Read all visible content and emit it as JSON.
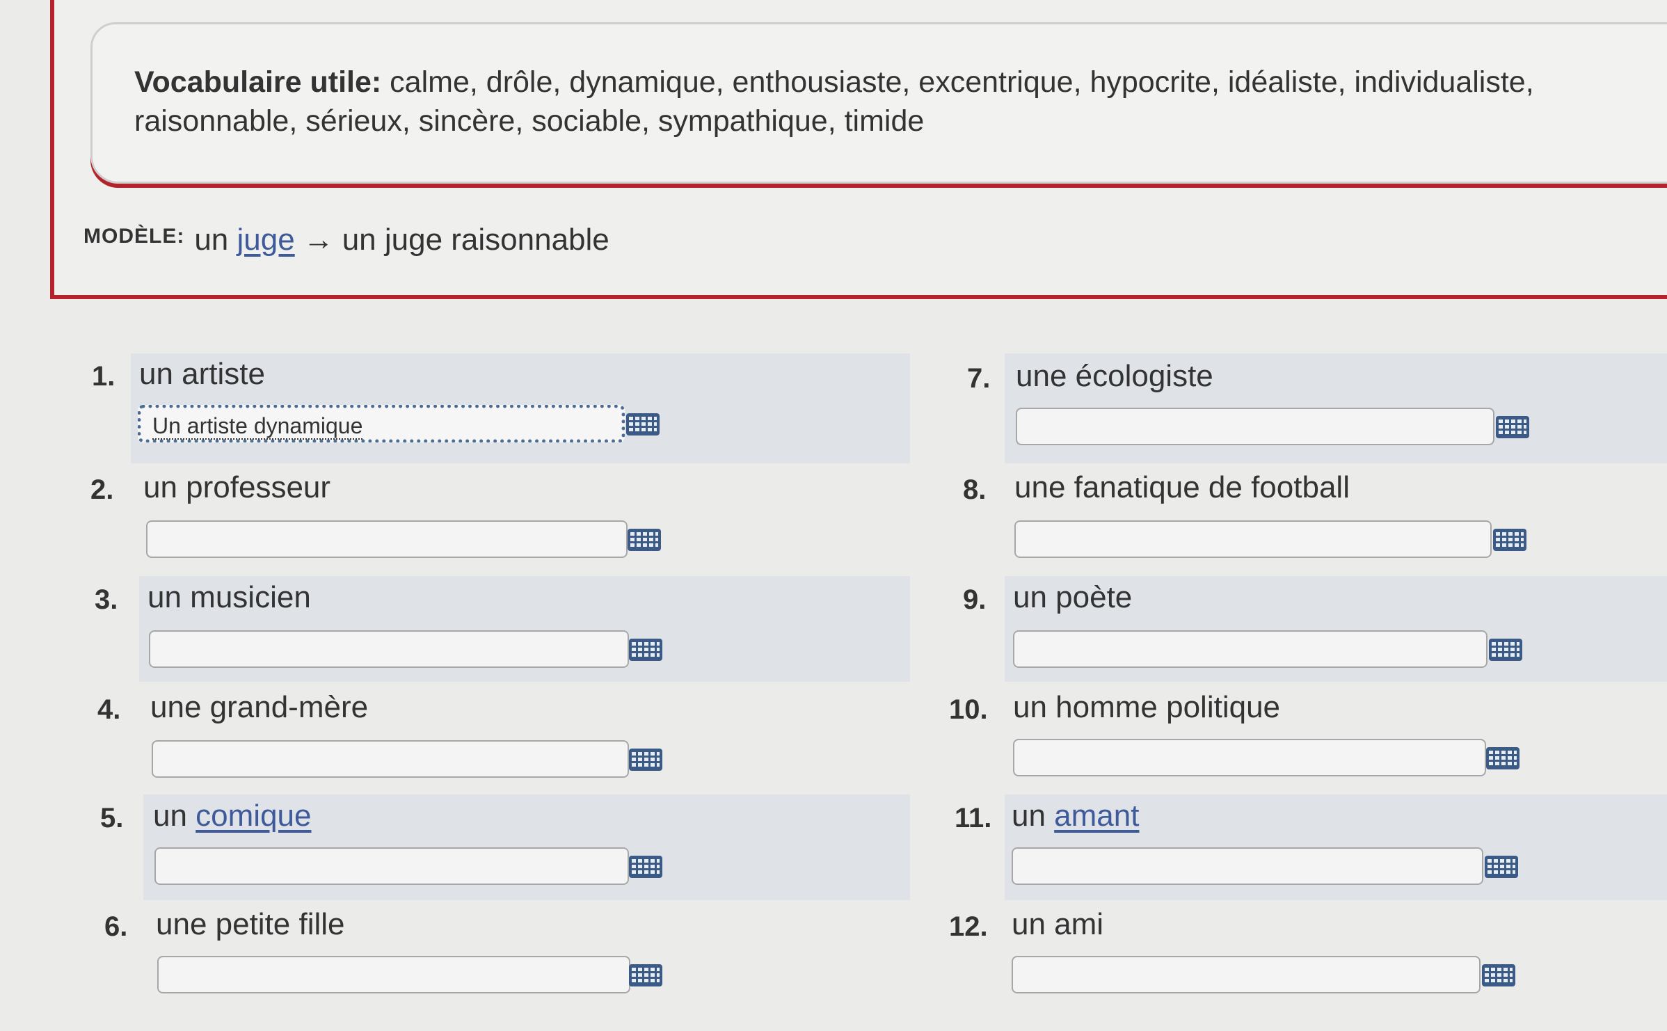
{
  "vocab": {
    "label": "Vocabulaire utile:",
    "words": " calme, drôle, dynamique, enthousiaste, excentrique, hypocrite, idéaliste, individualiste, raisonnable, sérieux, sincère, sociable, sympathique, timide"
  },
  "model": {
    "label": "MODÈLE:",
    "prefix": "un ",
    "noun": "juge",
    "arrow": "→",
    "answer": "un juge raisonnable"
  },
  "items": [
    {
      "num": "1.",
      "prefix": "un ",
      "noun": "artiste",
      "linked": false,
      "value": "Un artiste dynamique"
    },
    {
      "num": "2.",
      "prefix": "un ",
      "noun": "professeur",
      "linked": false,
      "value": ""
    },
    {
      "num": "3.",
      "prefix": "un ",
      "noun": "musicien",
      "linked": false,
      "value": ""
    },
    {
      "num": "4.",
      "prefix": "une ",
      "noun": "grand-mère",
      "linked": false,
      "value": ""
    },
    {
      "num": "5.",
      "prefix": "un ",
      "noun": "comique",
      "linked": true,
      "value": ""
    },
    {
      "num": "6.",
      "prefix": "une ",
      "noun": "petite fille",
      "linked": false,
      "value": ""
    },
    {
      "num": "7.",
      "prefix": "une ",
      "noun": "écologiste",
      "linked": false,
      "value": ""
    },
    {
      "num": "8.",
      "prefix": "une ",
      "noun": "fanatique de football",
      "linked": false,
      "value": ""
    },
    {
      "num": "9.",
      "prefix": "un ",
      "noun": "poète",
      "linked": false,
      "value": ""
    },
    {
      "num": "10.",
      "prefix": "un ",
      "noun": "homme politique",
      "linked": false,
      "value": ""
    },
    {
      "num": "11.",
      "prefix": "un ",
      "noun": "amant",
      "linked": true,
      "value": ""
    },
    {
      "num": "12.",
      "prefix": "un ",
      "noun": "ami",
      "linked": false,
      "value": ""
    }
  ],
  "icons": {
    "keyboard": "keyboard-icon"
  },
  "colors": {
    "accent_red": "#b3232b",
    "link_blue": "#3e5a9a",
    "keyboard_blue": "#3b5b86",
    "stripe": "#dfe3e8"
  }
}
